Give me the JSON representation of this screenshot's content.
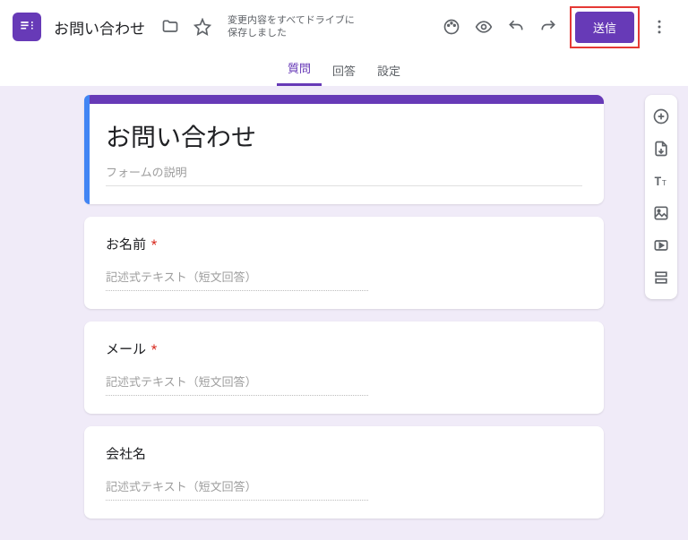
{
  "header": {
    "doc_title": "お問い合わせ",
    "save_status": "変更内容をすべてドライブに保存しました",
    "send_label": "送信"
  },
  "tabs": {
    "questions": "質問",
    "responses": "回答",
    "settings": "設定"
  },
  "form": {
    "title": "お問い合わせ",
    "description_placeholder": "フォームの説明"
  },
  "questions": [
    {
      "title": "お名前",
      "required": true,
      "answer_hint": "記述式テキスト（短文回答）"
    },
    {
      "title": "メール",
      "required": true,
      "answer_hint": "記述式テキスト（短文回答）"
    },
    {
      "title": "会社名",
      "required": false,
      "answer_hint": "記述式テキスト（短文回答）"
    }
  ],
  "required_mark": "*"
}
